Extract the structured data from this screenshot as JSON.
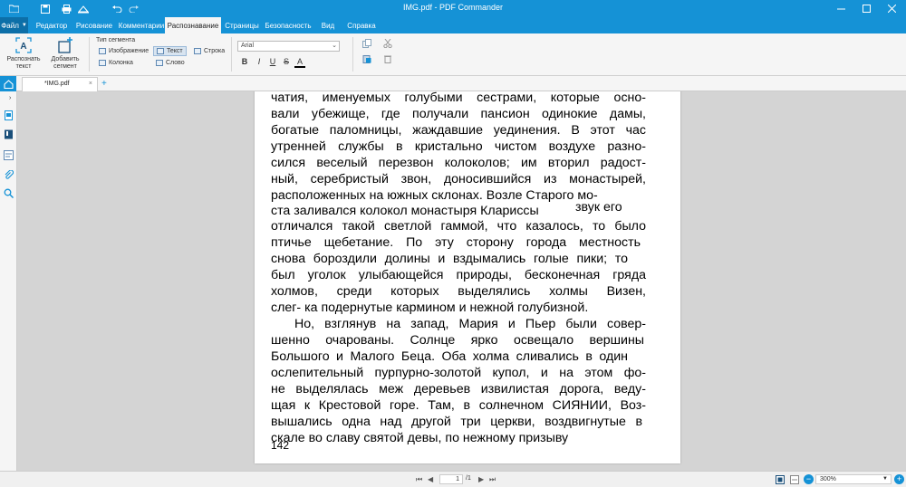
{
  "window": {
    "title": "IMG.pdf - PDF Commander"
  },
  "menu": {
    "file_label": "Файл",
    "tabs": [
      "Редактор",
      "Рисование",
      "Комментарии",
      "Распознавание",
      "Страницы",
      "Безопасность",
      "Вид",
      "Справка"
    ],
    "active_tab": "Распознавание"
  },
  "ribbon": {
    "recognize_text_label": "Распознать текст",
    "add_segment_label": "Добавить сегмент",
    "segment_type_label": "Тип сегмента",
    "segment_options": {
      "image": "Изображение",
      "text": "Текст",
      "line": "Строка",
      "column": "Колонка",
      "word": "Слово"
    },
    "font_value": "Arial",
    "format_bold": "B",
    "format_italic": "I",
    "format_underline": "U",
    "format_strike": "S",
    "format_color": "A"
  },
  "document_tab": {
    "name": "*IMG.pdf",
    "close": "×",
    "add": "+"
  },
  "page_content": {
    "lines": [
      "чатия, именуемых голубыми сестрами, которые осно-",
      "вали убежище, где получали пансион одинокие дамы,",
      "богатые паломницы, жаждавшие уединения. В этот час",
      "утренней службы в кристально чистом воздухе разно-",
      "сился веселый перезвон колоколов; им вторил радост-",
      "ный, серебристый звон, доносившийся из монастырей,",
      "расположенных на южных склонах. Возле Старого мо-",
      "ста заливался колокол монастыря Клариссы",
      "отличался такой светлой гаммой, что казалось, то было",
      "птичье щебетание. По эту сторону города местность",
      "снова бороздили долины и вздымались голые пики; то",
      "был уголок улыбающейся природы, бесконечная гряда",
      "холмов, среди которых выделялись холмы Визен,",
      "слег- ка подернутые кармином и нежной голубизной.",
      "Но, взглянув на запад, Мария и Пьер были совер-",
      "шенно очарованы. Солнце ярко освещало вершины",
      "Большого и Малого Беца. Оба холма сливались в один",
      "ослепительный пурпурно-золотой купол, и на этом фо-",
      "не выделялась меж деревьев извилистая дорога, веду-",
      "щая к Крестовой горе. Там, в солнечном СИЯНИИ, Воз-",
      "вышались одна над другой три церкви, воздвигнутые в",
      "скале во славу святой девы, по нежному призыву"
    ],
    "floating_fragment": "звук его",
    "page_number": "142"
  },
  "statusbar": {
    "page_current": "1",
    "page_total": "/1",
    "zoom": "300%"
  },
  "colors": {
    "accent": "#1592d6",
    "ribbon_bg": "#f5f5f5",
    "workspace_bg": "#d4d4d4"
  }
}
